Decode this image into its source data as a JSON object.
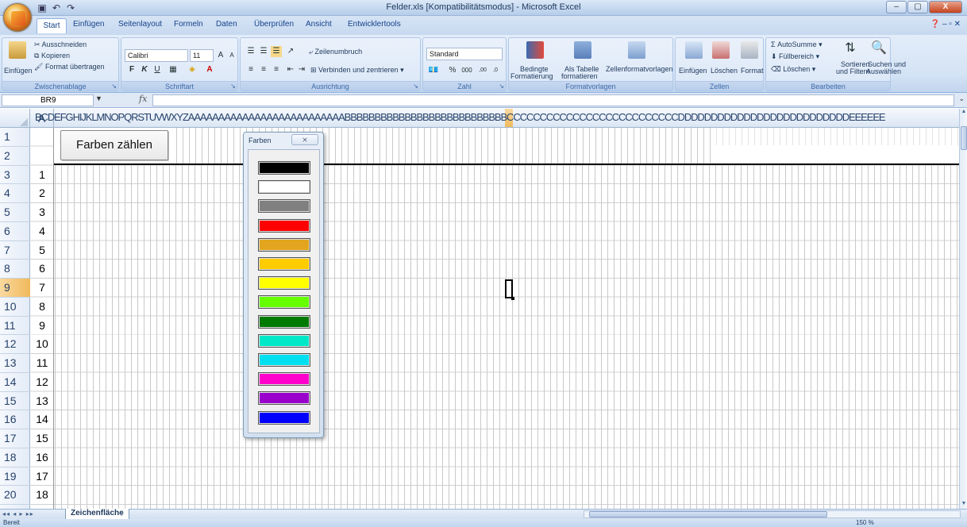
{
  "window": {
    "title": "Felder.xls  [Kompatibilitätsmodus]  -  Microsoft Excel",
    "minimize": "–",
    "maximize": "▢",
    "close": "X"
  },
  "tabs": [
    "Start",
    "Einfügen",
    "Seitenlayout",
    "Formeln",
    "Daten",
    "Überprüfen",
    "Ansicht",
    "Entwicklertools"
  ],
  "ribbon": {
    "clipboard": {
      "paste": "Einfügen",
      "cut": "Ausschneiden",
      "copy": "Kopieren",
      "format_painter": "Format übertragen",
      "label": "Zwischenablage"
    },
    "font": {
      "name": "Calibri",
      "size": "11",
      "bold": "F",
      "italic": "K",
      "underline": "U",
      "label": "Schriftart"
    },
    "alignment": {
      "wrap": "Zeilenumbruch",
      "merge": "Verbinden und zentrieren",
      "label": "Ausrichtung"
    },
    "number": {
      "format": "Standard",
      "percent": "%",
      "thousands": "000",
      "label": "Zahl"
    },
    "styles": {
      "conditional": "Bedingte",
      "conditional2": "Formatierung",
      "as_table": "Als Tabelle",
      "as_table2": "formatieren",
      "cell_styles": "Zellenformatvorlagen",
      "label": "Formatvorlagen"
    },
    "cells": {
      "insert": "Einfügen",
      "delete": "Löschen",
      "format": "Format",
      "label": "Zellen"
    },
    "editing": {
      "autosum": "AutoSumme",
      "fill": "Füllbereich",
      "clear": "Löschen",
      "sort": "Sortieren",
      "sort2": "und Filtern",
      "find": "Suchen und",
      "find2": "Auswählen",
      "label": "Bearbeiten"
    }
  },
  "formula_bar": {
    "name_box": "BR9",
    "fx": "fx",
    "value": ""
  },
  "grid": {
    "col_a": "A",
    "col_letters": "BCDEFGHIJKLMNOPQRSTUVWXYZAAAAAAAAAAAAAAAAAAAAAAAAAABBBBBBBBBBBBBBBBBBBBBBBBBBBCCCCCCCCCCCCCCCCCCCCCCCCCCDDDDDDDDDDDDDDDDDDDDDDDDDDEEEEEE",
    "rows": [
      "1",
      "2",
      "3",
      "4",
      "5",
      "6",
      "7",
      "8",
      "9",
      "10",
      "11",
      "12",
      "13",
      "14",
      "15",
      "16",
      "17",
      "18",
      "19",
      "20"
    ],
    "selected_row": "9",
    "col_a_values": [
      "1",
      "2",
      "3",
      "4",
      "5",
      "6",
      "7",
      "8",
      "9",
      "10",
      "11",
      "12",
      "13",
      "14",
      "15",
      "16",
      "17",
      "18"
    ]
  },
  "count_button": "Farben zählen",
  "palette": {
    "title": "Farben",
    "close": "⨯",
    "colors": [
      "#000000",
      "#FFFFFF",
      "#808080",
      "#FF0000",
      "#E3A51F",
      "#FFCC00",
      "#FFFF00",
      "#66FF00",
      "#007A00",
      "#00E8C8",
      "#00E0F0",
      "#FF00CC",
      "#9900CC",
      "#0000FF"
    ]
  },
  "sheet": {
    "tab": "Zeichenfläche",
    "nav": "◂◂ ◂ ▸ ▸▸"
  },
  "status": {
    "ready": "Bereit",
    "zoom": "150 %"
  }
}
